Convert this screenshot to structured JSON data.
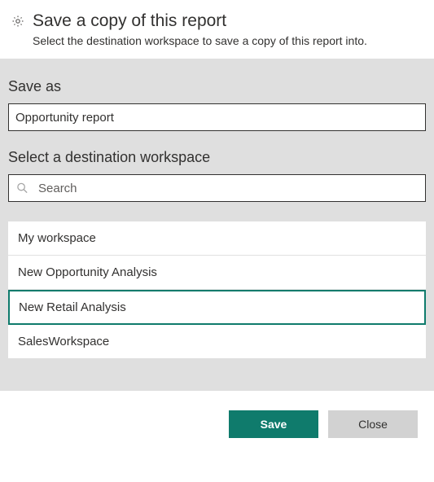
{
  "header": {
    "title": "Save a copy of this report",
    "subtitle": "Select the destination workspace to save a copy of this report into."
  },
  "form": {
    "save_as_label": "Save as",
    "save_as_value": "Opportunity report",
    "workspace_label": "Select a destination workspace",
    "search_placeholder": "Search"
  },
  "workspaces": {
    "items": [
      {
        "label": "My workspace"
      },
      {
        "label": "New Opportunity Analysis"
      },
      {
        "label": "New Retail Analysis"
      },
      {
        "label": "SalesWorkspace"
      }
    ],
    "selected_index": 2
  },
  "footer": {
    "save_label": "Save",
    "close_label": "Close"
  }
}
